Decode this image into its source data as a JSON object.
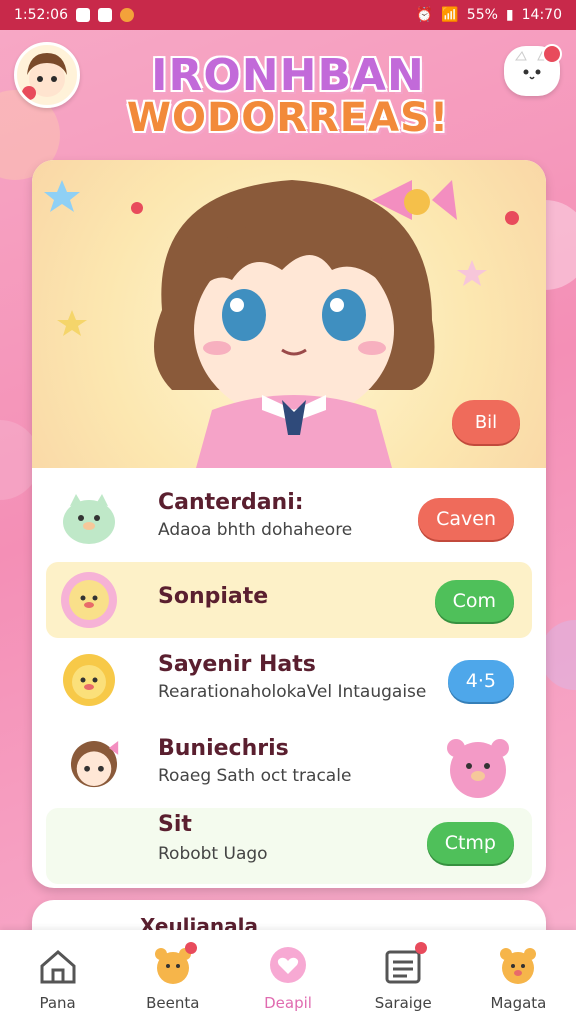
{
  "status": {
    "time_left": "1:52:06",
    "battery": "55%",
    "time_right": "14:70"
  },
  "app": {
    "title_line1": "IRONHBAN",
    "title_line2": "WODORREAS!"
  },
  "hero": {
    "button_label": "Bil"
  },
  "list": [
    {
      "title": "Canterdani:",
      "subtitle": "Adaoa bhth dohaheore",
      "button": "Caven",
      "color": "red"
    },
    {
      "title": "Sonpiate",
      "subtitle": "",
      "button": "Com",
      "color": "green",
      "highlight": true
    },
    {
      "title": "Sayenir Hats",
      "subtitle": "RearationaholokaVel Intaugaise",
      "button": "4·5",
      "color": "blue"
    },
    {
      "title": "Buniechris",
      "subtitle": "Roaeg Sath oct tracale",
      "button": "",
      "color": ""
    },
    {
      "title": "Sit",
      "subtitle": "Robobt Uago",
      "button": "Ctmp",
      "color": "green"
    }
  ],
  "peek": {
    "title": "Xeulianala"
  },
  "tabs": [
    {
      "label": "Pana",
      "icon": "home-icon"
    },
    {
      "label": "Beenta",
      "icon": "bear-icon"
    },
    {
      "label": "Deapil",
      "icon": "heart-chat-icon",
      "active": true
    },
    {
      "label": "Saraige",
      "icon": "calendar-list-icon"
    },
    {
      "label": "Magata",
      "icon": "bear-face-icon"
    }
  ],
  "colors": {
    "status_bar": "#c8294a",
    "accent_pink": "#e06bb0",
    "button_red": "#ef6b5b",
    "button_green": "#4fc05a",
    "button_blue": "#4ea7ea"
  }
}
